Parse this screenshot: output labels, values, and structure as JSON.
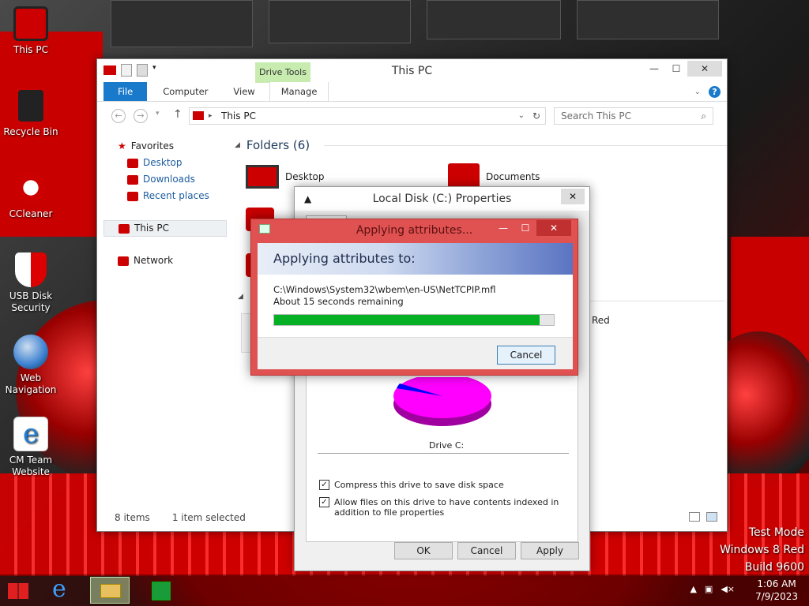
{
  "desktop": {
    "icons": [
      {
        "label": "This PC"
      },
      {
        "label": "Recycle Bin"
      },
      {
        "label": "CCleaner"
      },
      {
        "label": "USB Disk Security"
      },
      {
        "label": "Web Navigation"
      },
      {
        "label": "CM Team Website"
      }
    ],
    "watermark": {
      "line1": "Test Mode",
      "line2": "Windows 8 Red",
      "line3": "Build 9600"
    }
  },
  "explorer": {
    "title": "This PC",
    "context_tab_group": "Drive Tools",
    "tabs": [
      "File",
      "Computer",
      "View",
      "Manage"
    ],
    "address": "This PC",
    "search_placeholder": "Search This PC",
    "nav": {
      "favorites": "Favorites",
      "desktop": "Desktop",
      "downloads": "Downloads",
      "recent": "Recent places",
      "this_pc": "This PC",
      "network": "Network"
    },
    "folders_header": "Folders (6)",
    "folder_items": [
      "Desktop",
      "Documents"
    ],
    "drive_partial_label": "Red",
    "status": {
      "items": "8 items",
      "selected": "1 item selected"
    }
  },
  "properties": {
    "title": "Local Disk (C:) Properties",
    "drive_label": "Drive C:",
    "compress": "Compress this drive to save disk space",
    "index": "Allow files on this drive to have contents indexed in addition to file properties",
    "ok": "OK",
    "cancel": "Cancel",
    "apply": "Apply",
    "used_color": "#ff00ff",
    "free_color": "#0000ff"
  },
  "apply_dialog": {
    "title": "Applying attributes...",
    "header": "Applying attributes to:",
    "path": "C:\\Windows\\System32\\wbem\\en-US\\NetTCPIP.mfl",
    "remaining": "About 15 seconds remaining",
    "progress": 0.95,
    "cancel": "Cancel"
  },
  "taskbar": {
    "time": "1:06 AM",
    "date": "7/9/2023"
  }
}
